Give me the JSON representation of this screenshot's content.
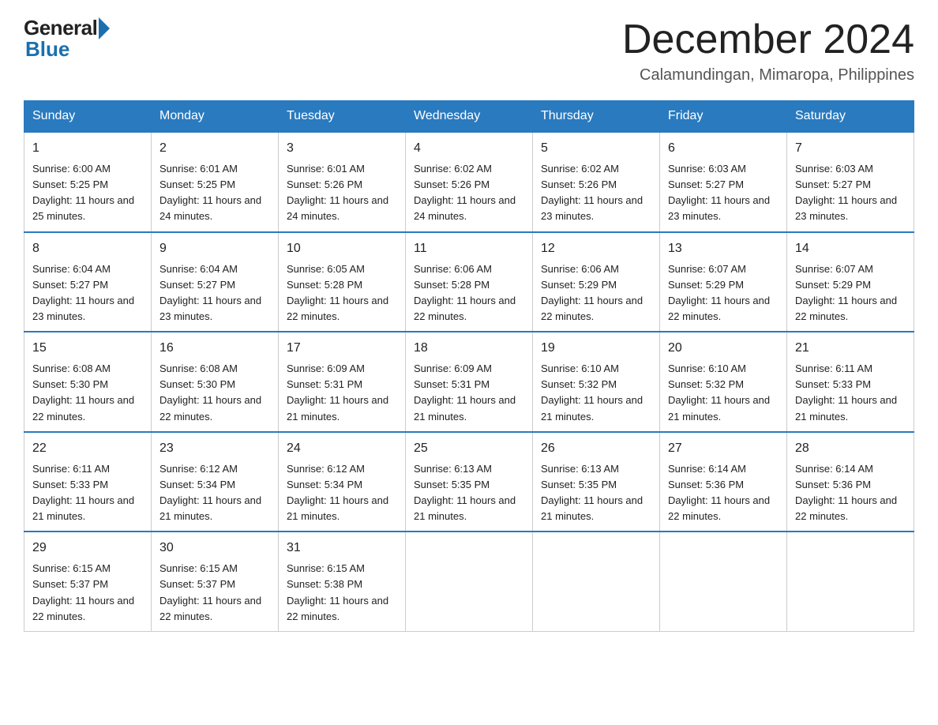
{
  "logo": {
    "general": "General",
    "blue": "Blue"
  },
  "title": {
    "month_year": "December 2024",
    "location": "Calamundingan, Mimaropa, Philippines"
  },
  "days_of_week": [
    "Sunday",
    "Monday",
    "Tuesday",
    "Wednesday",
    "Thursday",
    "Friday",
    "Saturday"
  ],
  "weeks": [
    [
      {
        "day": "1",
        "sunrise": "6:00 AM",
        "sunset": "5:25 PM",
        "daylight": "11 hours and 25 minutes."
      },
      {
        "day": "2",
        "sunrise": "6:01 AM",
        "sunset": "5:25 PM",
        "daylight": "11 hours and 24 minutes."
      },
      {
        "day": "3",
        "sunrise": "6:01 AM",
        "sunset": "5:26 PM",
        "daylight": "11 hours and 24 minutes."
      },
      {
        "day": "4",
        "sunrise": "6:02 AM",
        "sunset": "5:26 PM",
        "daylight": "11 hours and 24 minutes."
      },
      {
        "day": "5",
        "sunrise": "6:02 AM",
        "sunset": "5:26 PM",
        "daylight": "11 hours and 23 minutes."
      },
      {
        "day": "6",
        "sunrise": "6:03 AM",
        "sunset": "5:27 PM",
        "daylight": "11 hours and 23 minutes."
      },
      {
        "day": "7",
        "sunrise": "6:03 AM",
        "sunset": "5:27 PM",
        "daylight": "11 hours and 23 minutes."
      }
    ],
    [
      {
        "day": "8",
        "sunrise": "6:04 AM",
        "sunset": "5:27 PM",
        "daylight": "11 hours and 23 minutes."
      },
      {
        "day": "9",
        "sunrise": "6:04 AM",
        "sunset": "5:27 PM",
        "daylight": "11 hours and 23 minutes."
      },
      {
        "day": "10",
        "sunrise": "6:05 AM",
        "sunset": "5:28 PM",
        "daylight": "11 hours and 22 minutes."
      },
      {
        "day": "11",
        "sunrise": "6:06 AM",
        "sunset": "5:28 PM",
        "daylight": "11 hours and 22 minutes."
      },
      {
        "day": "12",
        "sunrise": "6:06 AM",
        "sunset": "5:29 PM",
        "daylight": "11 hours and 22 minutes."
      },
      {
        "day": "13",
        "sunrise": "6:07 AM",
        "sunset": "5:29 PM",
        "daylight": "11 hours and 22 minutes."
      },
      {
        "day": "14",
        "sunrise": "6:07 AM",
        "sunset": "5:29 PM",
        "daylight": "11 hours and 22 minutes."
      }
    ],
    [
      {
        "day": "15",
        "sunrise": "6:08 AM",
        "sunset": "5:30 PM",
        "daylight": "11 hours and 22 minutes."
      },
      {
        "day": "16",
        "sunrise": "6:08 AM",
        "sunset": "5:30 PM",
        "daylight": "11 hours and 22 minutes."
      },
      {
        "day": "17",
        "sunrise": "6:09 AM",
        "sunset": "5:31 PM",
        "daylight": "11 hours and 21 minutes."
      },
      {
        "day": "18",
        "sunrise": "6:09 AM",
        "sunset": "5:31 PM",
        "daylight": "11 hours and 21 minutes."
      },
      {
        "day": "19",
        "sunrise": "6:10 AM",
        "sunset": "5:32 PM",
        "daylight": "11 hours and 21 minutes."
      },
      {
        "day": "20",
        "sunrise": "6:10 AM",
        "sunset": "5:32 PM",
        "daylight": "11 hours and 21 minutes."
      },
      {
        "day": "21",
        "sunrise": "6:11 AM",
        "sunset": "5:33 PM",
        "daylight": "11 hours and 21 minutes."
      }
    ],
    [
      {
        "day": "22",
        "sunrise": "6:11 AM",
        "sunset": "5:33 PM",
        "daylight": "11 hours and 21 minutes."
      },
      {
        "day": "23",
        "sunrise": "6:12 AM",
        "sunset": "5:34 PM",
        "daylight": "11 hours and 21 minutes."
      },
      {
        "day": "24",
        "sunrise": "6:12 AM",
        "sunset": "5:34 PM",
        "daylight": "11 hours and 21 minutes."
      },
      {
        "day": "25",
        "sunrise": "6:13 AM",
        "sunset": "5:35 PM",
        "daylight": "11 hours and 21 minutes."
      },
      {
        "day": "26",
        "sunrise": "6:13 AM",
        "sunset": "5:35 PM",
        "daylight": "11 hours and 21 minutes."
      },
      {
        "day": "27",
        "sunrise": "6:14 AM",
        "sunset": "5:36 PM",
        "daylight": "11 hours and 22 minutes."
      },
      {
        "day": "28",
        "sunrise": "6:14 AM",
        "sunset": "5:36 PM",
        "daylight": "11 hours and 22 minutes."
      }
    ],
    [
      {
        "day": "29",
        "sunrise": "6:15 AM",
        "sunset": "5:37 PM",
        "daylight": "11 hours and 22 minutes."
      },
      {
        "day": "30",
        "sunrise": "6:15 AM",
        "sunset": "5:37 PM",
        "daylight": "11 hours and 22 minutes."
      },
      {
        "day": "31",
        "sunrise": "6:15 AM",
        "sunset": "5:38 PM",
        "daylight": "11 hours and 22 minutes."
      },
      null,
      null,
      null,
      null
    ]
  ]
}
